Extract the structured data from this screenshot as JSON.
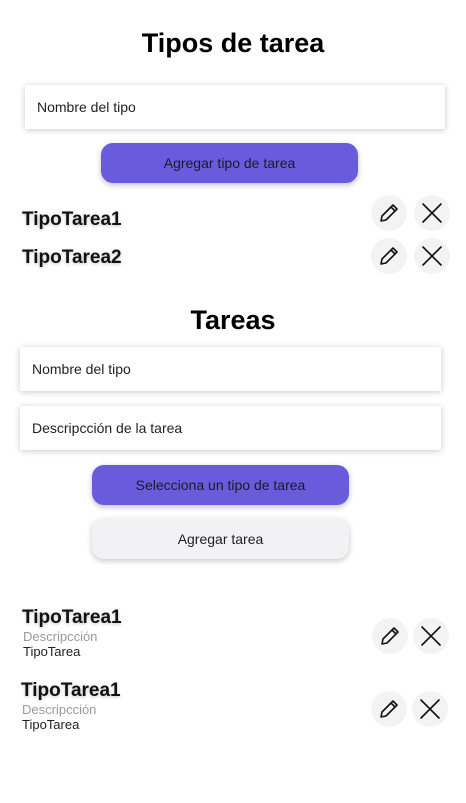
{
  "types_section": {
    "title": "Tipos de tarea",
    "name_input_placeholder": "Nombre del tipo",
    "add_button": "Agregar tipo de tarea",
    "items": [
      {
        "label": "TipoTarea1"
      },
      {
        "label": "TipoTarea2"
      }
    ]
  },
  "tasks_section": {
    "title": "Tareas",
    "name_input_placeholder": "Nombre del tipo",
    "description_input_placeholder": "Descripcción de la tarea",
    "select_type_button": "Selecciona un tipo de tarea",
    "add_button": "Agregar tarea",
    "items": [
      {
        "title": "TipoTarea1",
        "description": "Descripcción",
        "type": "TipoTarea"
      },
      {
        "title": "TipoTarea1",
        "description": "Descripcción",
        "type": "TipoTarea"
      }
    ]
  },
  "colors": {
    "primary_button": "#6a5bdc",
    "secondary_button": "#f2f2f5",
    "icon_button_bg": "#f3f3f3"
  },
  "icons": {
    "edit": "pencil-icon",
    "delete": "close-icon"
  }
}
